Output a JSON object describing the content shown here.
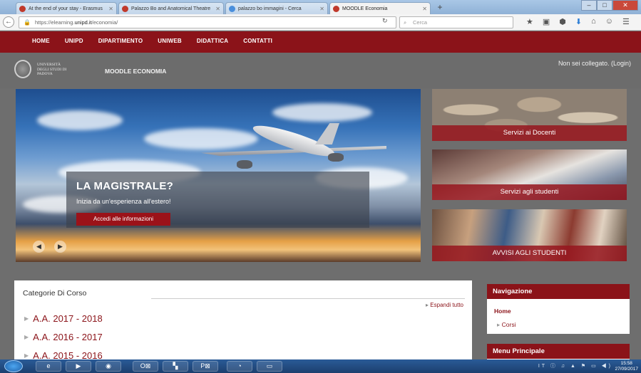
{
  "browser": {
    "tabs": [
      {
        "title": "At the end of your stay - Erasmus",
        "favicon": "red-circle-icon"
      },
      {
        "title": "Palazzo Bo and Anatomical Theatre",
        "favicon": "red-circle-icon"
      },
      {
        "title": "palazzo bo immagini - Cerca",
        "favicon": "google-icon"
      },
      {
        "title": "MOODLE Economia",
        "favicon": "red-circle-icon",
        "active": true
      }
    ],
    "url_prefix": "https://elearning.",
    "url_domain": "unipd.it",
    "url_path": "/economia/",
    "search_placeholder": "Cerca",
    "toolbar_icons": [
      "★",
      "▣",
      "⬢",
      "⬇",
      "⌂",
      "☺",
      "☰"
    ]
  },
  "site": {
    "top_menu": [
      "HOME",
      "UNIPD",
      "DIPARTIMENTO",
      "UNIWEB",
      "DIDATTICA",
      "CONTATTI"
    ],
    "logo_text": "UNIVERSITÀ DEGLI STUDI DI PADOVA",
    "site_name": "MOODLE ECONOMIA",
    "login_text": "Non sei collegato. (Login)"
  },
  "slider": {
    "title": "LA MAGISTRALE?",
    "subtitle": "Inizia da un'esperienza all'estero!",
    "button": "Accedi alle informazioni"
  },
  "panels": [
    {
      "label": "Servizi ai Docenti"
    },
    {
      "label": "Servizi agli studenti"
    },
    {
      "label": "AVVISI AGLI STUDENTI"
    }
  ],
  "categories": {
    "title": "Categorie Di Corso",
    "expand_all": "Espandi tutto",
    "items": [
      "A.A. 2017 - 2018",
      "A.A. 2016 - 2017",
      "A.A. 2015 - 2016"
    ]
  },
  "navigation": {
    "title": "Navigazione",
    "home": "Home",
    "corsi": "Corsi"
  },
  "main_menu": {
    "title": "Menu Principale"
  },
  "taskbar": {
    "apps": [
      "e",
      "▶",
      "◉",
      "O⊠",
      "▚",
      "P⊠",
      "◔",
      "▭"
    ],
    "tray": "IT ⓘ ♫ ▲ ⚑ ▭ ◀)",
    "time": "15:58",
    "date": "27/09/2017"
  },
  "colors": {
    "brand": "#8b1319",
    "header_gray": "#6c6c6c"
  }
}
